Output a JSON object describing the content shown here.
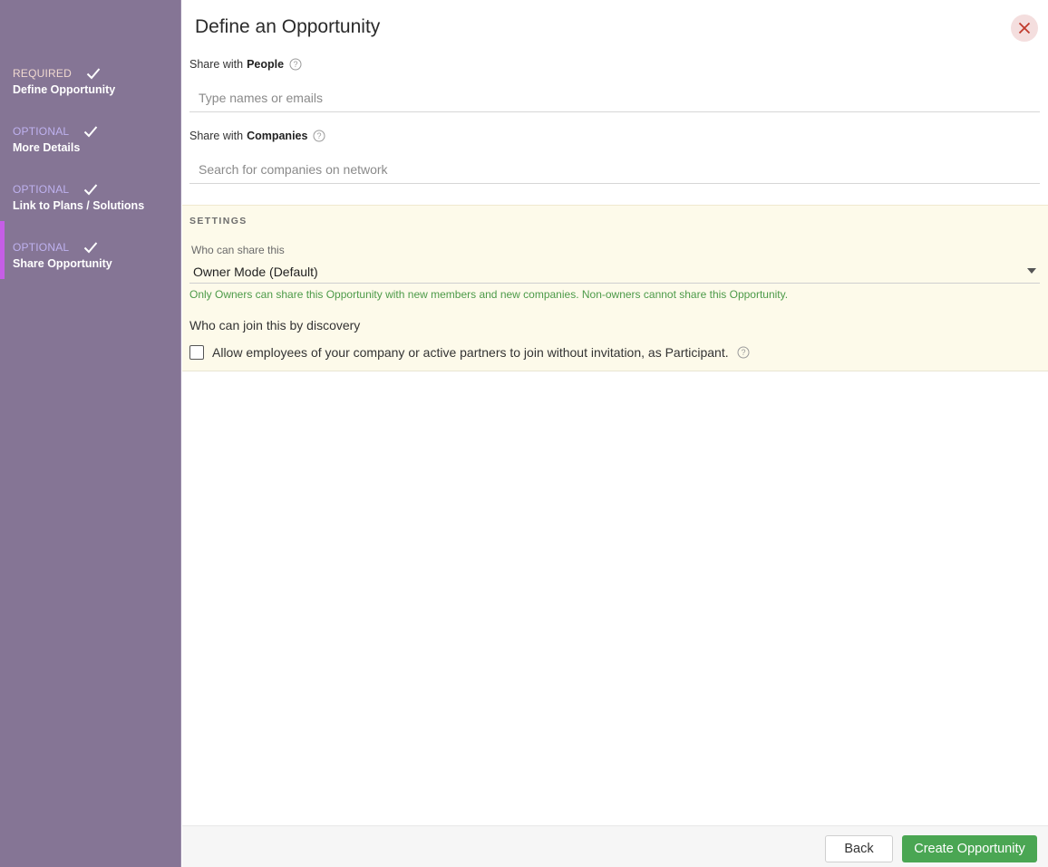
{
  "sidebar": {
    "steps": [
      {
        "tag": "REQUIRED",
        "label": "Define Opportunity",
        "completed": true,
        "active": false
      },
      {
        "tag": "OPTIONAL",
        "label": "More Details",
        "completed": true,
        "active": false
      },
      {
        "tag": "OPTIONAL",
        "label": "Link to Plans / Solutions",
        "completed": true,
        "active": false
      },
      {
        "tag": "OPTIONAL",
        "label": "Share Opportunity",
        "completed": true,
        "active": true
      }
    ]
  },
  "header": {
    "title": "Define an Opportunity",
    "close_icon": "close-icon"
  },
  "share_people": {
    "label_prefix": "Share with",
    "label_bold": "People",
    "placeholder": "Type names or emails",
    "value": ""
  },
  "share_companies": {
    "label_prefix": "Share with",
    "label_bold": "Companies",
    "placeholder": "Search for companies on network",
    "value": ""
  },
  "settings": {
    "heading": "SETTINGS",
    "who_can_share_label": "Who can share this",
    "who_can_share_value": "Owner Mode (Default)",
    "who_can_share_hint": "Only Owners can share this Opportunity with new members and new companies. Non-owners cannot share this Opportunity.",
    "discovery_heading": "Who can join this by discovery",
    "discovery_checkbox_label": "Allow employees of your company or active partners to join without invitation, as Participant.",
    "discovery_checked": false
  },
  "footer": {
    "back_label": "Back",
    "create_label": "Create Opportunity"
  },
  "colors": {
    "sidebar_bg": "#857595",
    "active_marker": "#c55ee6",
    "settings_bg": "#fdfaea",
    "hint_text": "#4c9a48",
    "primary_button": "#4aa653",
    "close_bg": "#f4dede",
    "close_x": "#c0392b"
  }
}
